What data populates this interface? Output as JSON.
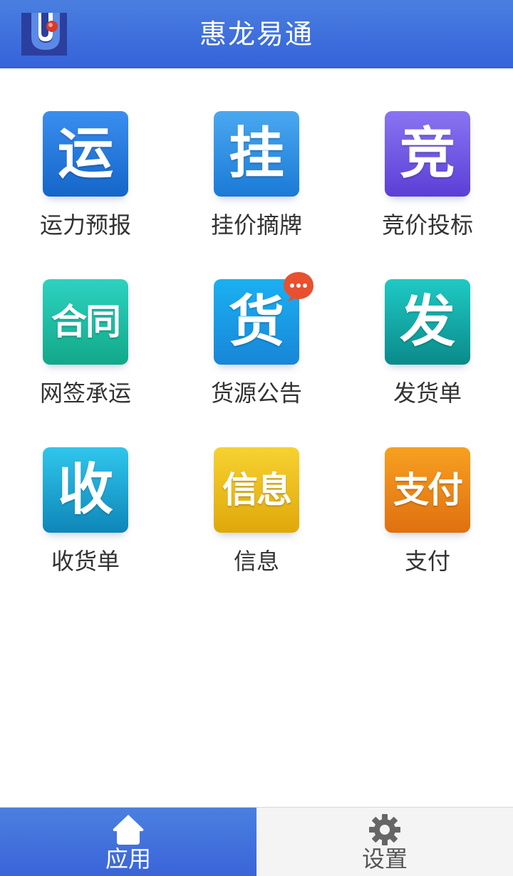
{
  "header": {
    "title": "惠龙易通",
    "logo_icon": "huilong-logo-icon"
  },
  "colors": {
    "header_blue": "#3d6fdc",
    "tab_active_blue": "#4175dc",
    "badge_red": "#e8502f"
  },
  "tiles": [
    {
      "glyph": "运",
      "label": "运力预报",
      "icon": "capacity-forecast-icon",
      "color_top": "#3a8ef0",
      "color_bottom": "#1466c8"
    },
    {
      "glyph": "挂",
      "label": "挂价摘牌",
      "icon": "listing-price-icon",
      "color_top": "#4aa8f0",
      "color_bottom": "#1a7ad6"
    },
    {
      "glyph": "竞",
      "label": "竞价投标",
      "icon": "bidding-icon",
      "color_top": "#8a74f2",
      "color_bottom": "#5b3fd6"
    },
    {
      "glyph": "合同",
      "label": "网签承运",
      "icon": "contract-icon",
      "color_top": "#2dd2c0",
      "color_bottom": "#12a88a"
    },
    {
      "glyph": "货",
      "label": "货源公告",
      "icon": "cargo-notice-icon",
      "color_top": "#1ab0f2",
      "color_bottom": "#1886d8"
    },
    {
      "glyph": "发",
      "label": "发货单",
      "icon": "shipping-order-icon",
      "color_top": "#1fcac4",
      "color_bottom": "#0a8a8a"
    },
    {
      "glyph": "收",
      "label": "收货单",
      "icon": "receipt-order-icon",
      "color_top": "#30c6ec",
      "color_bottom": "#0e86b8"
    },
    {
      "glyph": "信息",
      "label": "信息",
      "icon": "info-icon",
      "color_top": "#f6d230",
      "color_bottom": "#e0a80a"
    },
    {
      "glyph": "支付",
      "label": "支付",
      "icon": "payment-icon",
      "color_top": "#f7a020",
      "color_bottom": "#e07010"
    }
  ],
  "badge": {
    "icon": "chat-bubble-icon",
    "text": "•••"
  },
  "bottom_nav": {
    "apps": {
      "label": "应用",
      "icon": "home-icon"
    },
    "settings": {
      "label": "设置",
      "icon": "gear-icon"
    }
  }
}
